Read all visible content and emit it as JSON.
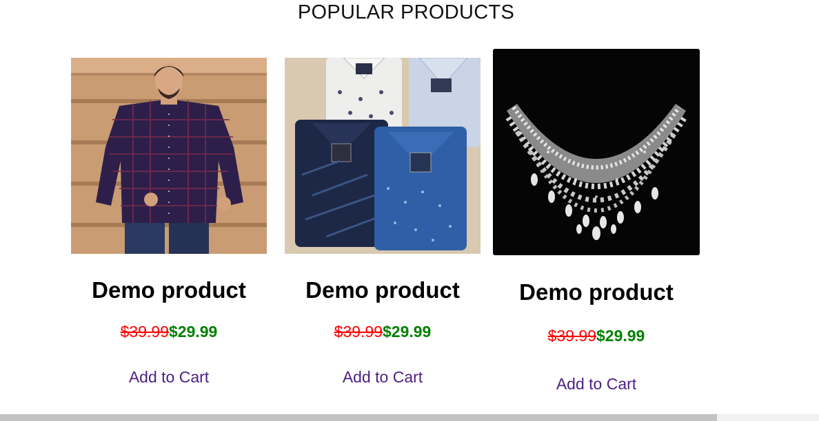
{
  "section": {
    "title": "POPULAR PRODUCTS"
  },
  "products": [
    {
      "image_subject": "man-in-checked-shirt",
      "name": "Demo product",
      "old_price": "$39.99",
      "new_price": "$29.99",
      "cta": "Add to Cart"
    },
    {
      "image_subject": "folded-printed-shirts",
      "name": "Demo product",
      "old_price": "$39.99",
      "new_price": "$29.99",
      "cta": "Add to Cart"
    },
    {
      "image_subject": "diamond-necklace",
      "name": "Demo product",
      "old_price": "$39.99",
      "new_price": "$29.99",
      "cta": "Add to Cart"
    }
  ],
  "colors": {
    "old_price": "#ff0000",
    "new_price": "#008000",
    "link": "#4b1f82"
  },
  "scrollbar": {
    "horizontal_visible_fraction": 0.875
  }
}
